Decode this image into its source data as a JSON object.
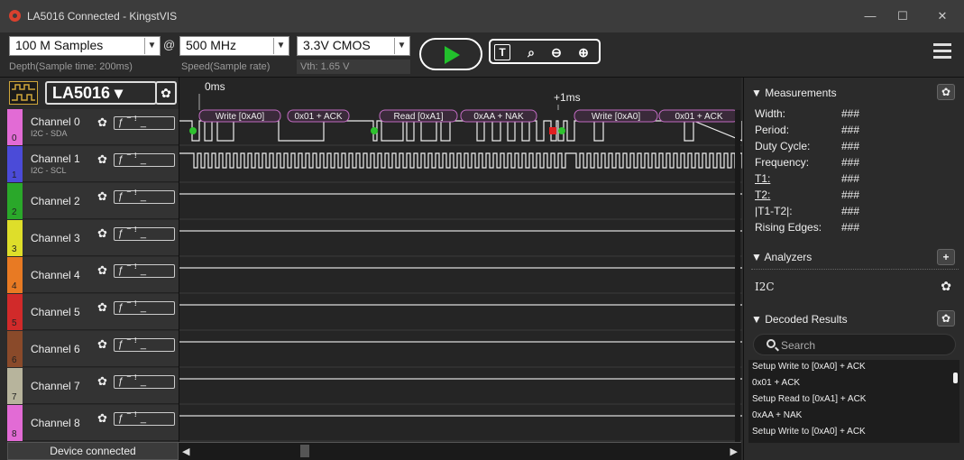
{
  "window": {
    "title": "LA5016 Connected - KingstVIS",
    "min": "—",
    "max": "☐",
    "close": "✕"
  },
  "toolbar": {
    "samples": "100 M Samples",
    "at": "@",
    "rate": "500 MHz",
    "voltage": "3.3V CMOS",
    "depth_label": "Depth(Sample time: 200ms)",
    "speed_label": "Speed(Sample rate)",
    "vth_label": "Vth: 1.65 V"
  },
  "device": {
    "name": "LA5016 ▾"
  },
  "time": {
    "t0": "0ms",
    "t1": "+1ms"
  },
  "channels": [
    {
      "name": "Channel 0",
      "num": "0",
      "sub": "I2C - SDA",
      "color": "#e26bd5"
    },
    {
      "name": "Channel 1",
      "num": "1",
      "sub": "I2C - SCL",
      "color": "#4b4bd8"
    },
    {
      "name": "Channel 2",
      "num": "2",
      "sub": "",
      "color": "#2aa82a"
    },
    {
      "name": "Channel 3",
      "num": "3",
      "sub": "",
      "color": "#dede2a"
    },
    {
      "name": "Channel 4",
      "num": "4",
      "sub": "",
      "color": "#e87a23"
    },
    {
      "name": "Channel 5",
      "num": "5",
      "sub": "",
      "color": "#d12a2a"
    },
    {
      "name": "Channel 6",
      "num": "6",
      "sub": "",
      "color": "#8a4a2a"
    },
    {
      "name": "Channel 7",
      "num": "7",
      "sub": "",
      "color": "#b7b49c"
    },
    {
      "name": "Channel 8",
      "num": "8",
      "sub": "",
      "color": "#e26bd5"
    }
  ],
  "decodes": [
    "Write [0xA0]",
    "0x01 + ACK",
    "Read [0xA1]",
    "0xAA + NAK",
    "Write [0xA0]",
    "0x01 + ACK"
  ],
  "status": "Device connected",
  "measurements": {
    "header": "▼ Measurements",
    "rows": [
      {
        "label": "Width:",
        "value": "###"
      },
      {
        "label": "Period:",
        "value": "###"
      },
      {
        "label": "Duty Cycle:",
        "value": "###"
      },
      {
        "label": "Frequency:",
        "value": "###"
      },
      {
        "label": "T1:",
        "value": "###"
      },
      {
        "label": "T2:",
        "value": "###"
      },
      {
        "label": "|T1-T2|:",
        "value": "###"
      },
      {
        "label": "Rising Edges:",
        "value": "###"
      }
    ]
  },
  "analyzers": {
    "header": "▼ Analyzers",
    "items": [
      "I2C"
    ],
    "add": "+"
  },
  "decoded": {
    "header": "▼ Decoded Results",
    "search_placeholder": "Search",
    "results": [
      "Setup Write to [0xA0] + ACK",
      "0x01 + ACK",
      "Setup Read to [0xA1] + ACK",
      "0xAA + NAK",
      "Setup Write to [0xA0] + ACK"
    ]
  }
}
